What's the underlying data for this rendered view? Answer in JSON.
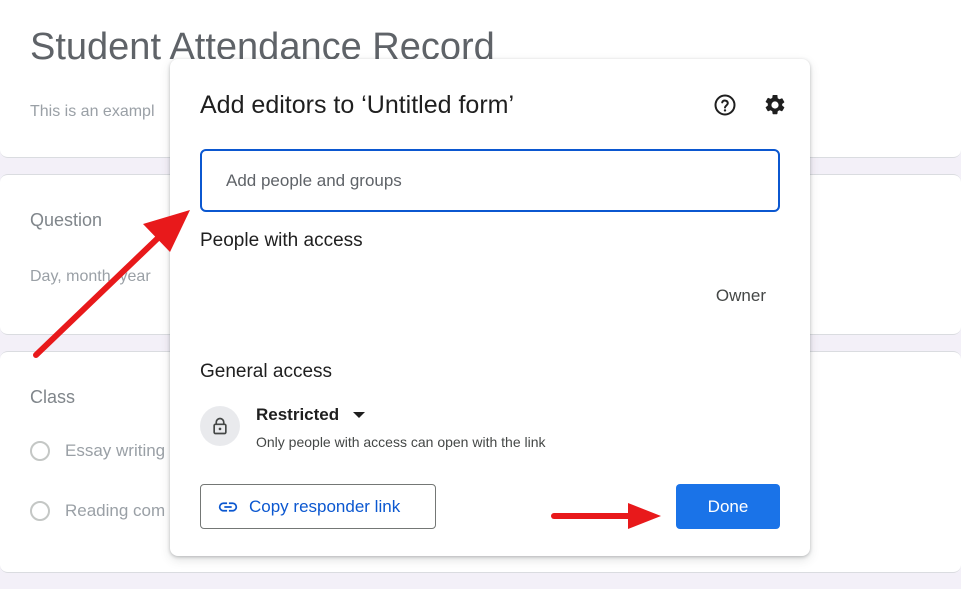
{
  "background_form": {
    "title": "Student Attendance Record",
    "description": "This is an exampl",
    "question1": {
      "label": "Question",
      "hint": "Day, month, year"
    },
    "question2": {
      "label": "Class",
      "options": [
        "Essay writing",
        "Reading com"
      ]
    }
  },
  "dialog": {
    "title": "Add editors to ‘Untitled form’",
    "help_icon": "help-circle-icon",
    "settings_icon": "gear-icon",
    "add_input": {
      "placeholder": "Add people and groups",
      "value": ""
    },
    "people_with_access": {
      "heading": "People with access",
      "role": "Owner"
    },
    "general_access": {
      "heading": "General access",
      "selected": "Restricted",
      "description": "Only people with access can open with the link",
      "icon": "lock-icon"
    },
    "copy_link_button": {
      "label": "Copy responder link",
      "icon": "link-icon"
    },
    "done_button": {
      "label": "Done"
    }
  },
  "colors": {
    "primary_blue": "#1a73e8",
    "link_blue": "#0b57d0",
    "annotation_red": "#e8191b"
  }
}
